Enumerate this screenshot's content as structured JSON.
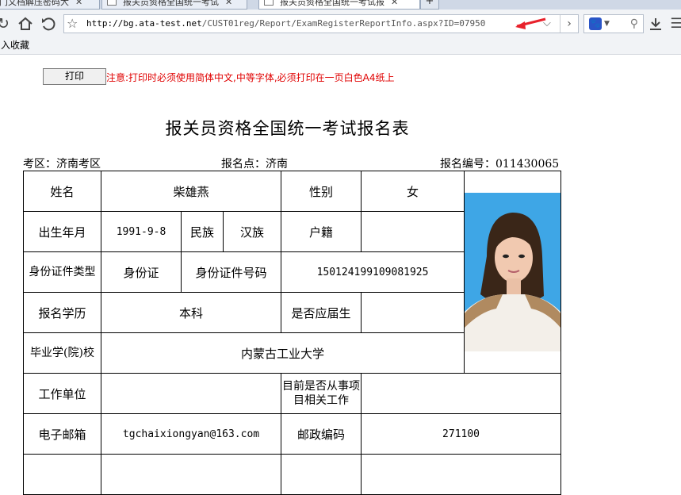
{
  "browser": {
    "tabs": [
      {
        "title": "门文档解压密码大"
      },
      {
        "title": "报关员资格全国统一考试"
      },
      {
        "title": "报关员资格全国统一考试报"
      }
    ],
    "url_host": "http://bg.ata-test.net",
    "url_path": "/CUST01reg/Report/ExamRegisterReportInfo.aspx?ID=07950",
    "bookmark": "入收藏",
    "icons": [
      "back-icon",
      "home-icon",
      "refresh-icon",
      "star-icon",
      "dropdown-icon",
      "forward-icon",
      "search-engine-icon",
      "magnifier-icon",
      "download-icon",
      "menu-icon"
    ],
    "annotation_color": "#e8212b"
  },
  "page": {
    "print_label": "打印",
    "notice": "注意:打印时必须使用简体中文,中等字体,必须打印在一页白色A4纸上",
    "notice_color": "#e00000",
    "title": "报关员资格全国统一考试报名表",
    "exam_area": "考区：济南考区",
    "reg_point": "报名点：济南",
    "reg_number": "报名编号：011430065"
  },
  "form": {
    "name_label": "姓名",
    "name": "柴雄燕",
    "gender_label": "性别",
    "gender": "女",
    "birth_label": "出生年月",
    "birth": "1991-9-8",
    "ethnicity_label": "民族",
    "ethnicity": "汉族",
    "hukou_label": "户籍",
    "hukou": "",
    "id_type_label": "身份证件类型",
    "id_type": "身份证",
    "id_no_label": "身份证件号码",
    "id_no": "150124199109081925",
    "edu_label": "报名学历",
    "edu": "本科",
    "fresh_grad_label": "是否应届生",
    "fresh_grad": "",
    "school_label": "毕业学(院)校",
    "school": "内蒙古工业大学",
    "employer_label": "工作单位",
    "employer": "",
    "related_work_label": "目前是否从事项目相关工作",
    "related_work": "",
    "email_label": "电子邮箱",
    "email": "tgchaixiongyan@163.com",
    "postcode_label": "邮政编码",
    "postcode": "271100"
  }
}
